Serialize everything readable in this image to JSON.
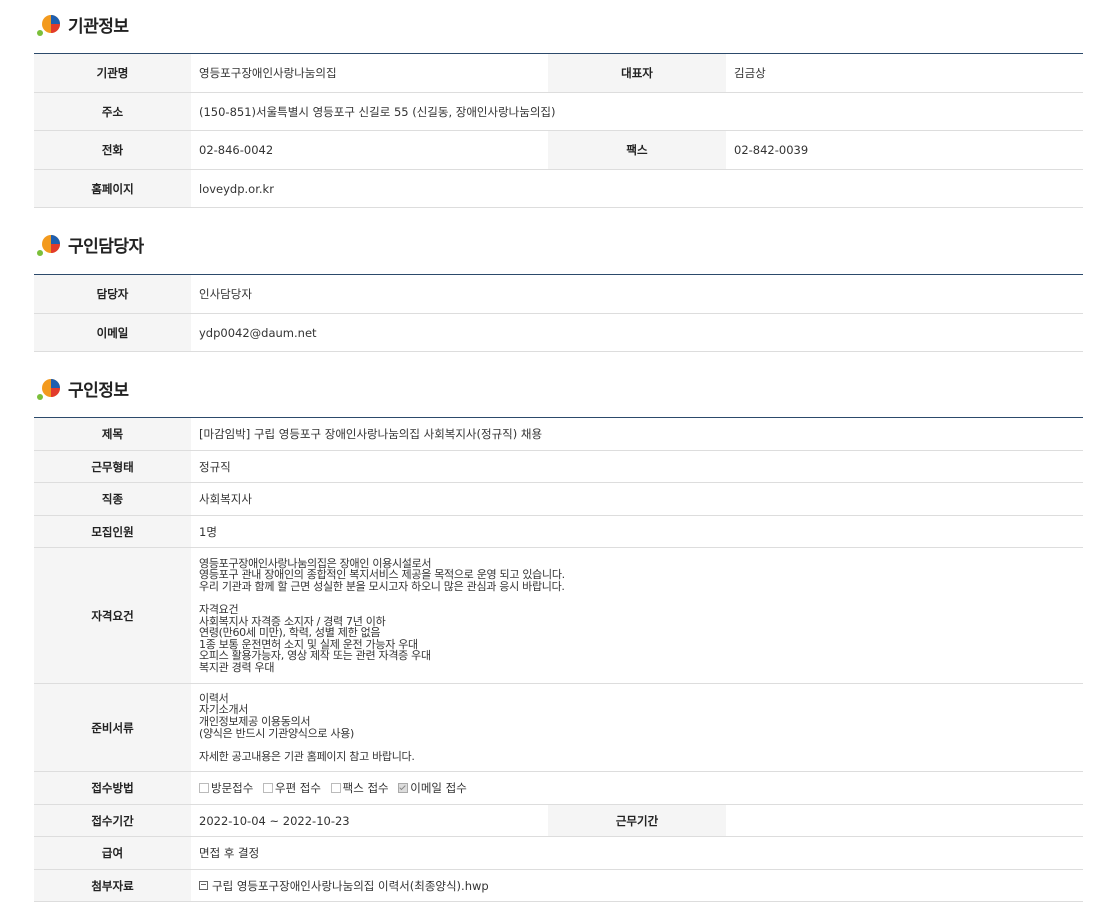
{
  "sections": {
    "org": {
      "title": "기관정보",
      "rows": {
        "name_label": "기관명",
        "name_value": "영등포구장애인사랑나눔의집",
        "rep_label": "대표자",
        "rep_value": "김금상",
        "addr_label": "주소",
        "addr_value": "(150-851)서울특별시 영등포구 신길로 55 (신길동, 장애인사랑나눔의집)",
        "phone_label": "전화",
        "phone_value": "02-846-0042",
        "fax_label": "팩스",
        "fax_value": "02-842-0039",
        "homepage_label": "홈페이지",
        "homepage_value": "loveydp.or.kr"
      }
    },
    "contact": {
      "title": "구인담당자",
      "rows": {
        "person_label": "담당자",
        "person_value": "인사담당자",
        "email_label": "이메일",
        "email_value": "ydp0042@daum.net"
      }
    },
    "job": {
      "title": "구인정보",
      "rows": {
        "subject_label": "제목",
        "subject_value": "[마감임박] 구립 영등포구 장애인사랑나눔의집 사회복지사(정규직) 채용",
        "worktype_label": "근무형태",
        "worktype_value": "정규직",
        "occupation_label": "직종",
        "occupation_value": "사회복지사",
        "headcount_label": "모집인원",
        "headcount_value": "1명",
        "qual_label": "자격요건",
        "qual_value": "영등포구장애인사랑나눔의집은 장애인 이용시설로서\n영등포구 관내 장애인의 종합적인 복지서비스 제공을 목적으로 운영 되고 있습니다.\n우리 기관과 함께 할 근면 성실한 분을 모시고자 하오니 많은 관심과 응시 바랍니다.\n\n자격요건\n사회복지사 자격증 소지자 / 경력 7년 이하\n연령(만60세 미만), 학력, 성별 제한 없음\n1종 보통 운전면허 소지 및 실제 운전 가능자 우대\n오피스 활용가능자, 영상 제작 또는 관련 자격증 우대\n복지관 경력 우대",
        "docs_label": "준비서류",
        "docs_value": "이력서\n자기소개서\n개인정보제공 이용동의서\n(양식은 반드시 기관양식으로 사용)\n\n자세한 공고내용은 기관 홈페이지 참고 바랍니다.",
        "method_label": "접수방법",
        "methods": [
          {
            "label": "방문접수",
            "checked": false
          },
          {
            "label": "우편 접수",
            "checked": false
          },
          {
            "label": "팩스 접수",
            "checked": false
          },
          {
            "label": "이메일 접수",
            "checked": true
          }
        ],
        "period_label": "접수기간",
        "period_value": "2022-10-04 ~ 2022-10-23",
        "workperiod_label": "근무기간",
        "workperiod_value": "",
        "salary_label": "급여",
        "salary_value": "면접 후 결정",
        "attach_label": "첨부자료",
        "attach_value": "구립 영등포구장애인사랑나눔의집 이력서(최종양식).hwp"
      }
    }
  },
  "colors": {
    "header_border": "#2c4a6b",
    "label_bg": "#f5f5f5",
    "logo_orange": "#f39a1e",
    "logo_blue": "#1f5fb0",
    "logo_red": "#e23b2c",
    "logo_green": "#7bbf3a"
  },
  "icons": {
    "section_logo": "colorful-leaf-logo-icon",
    "checkbox": "checkbox-icon",
    "file": "file-icon"
  }
}
